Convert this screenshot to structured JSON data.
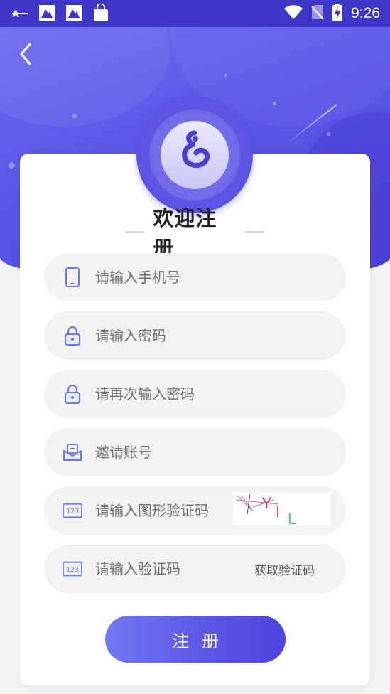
{
  "status_bar": {
    "time": "9:26"
  },
  "page": {
    "title": "欢迎注册"
  },
  "form": {
    "phone": {
      "placeholder": "请输入手机号"
    },
    "password": {
      "placeholder": "请输入密码"
    },
    "password_confirm": {
      "placeholder": "请再次输入密码"
    },
    "invite": {
      "placeholder": "邀请账号"
    },
    "image_captcha": {
      "placeholder": "请输入图形验证码",
      "captcha_text": "YIL"
    },
    "sms_code": {
      "placeholder": "请输入验证码",
      "action_label": "获取验证码"
    },
    "submit_label": "注册"
  },
  "colors": {
    "primary": "#5a55e4",
    "accent_light": "#6f78f2",
    "field_bg": "#f2f2f4",
    "icon": "#6b78ea"
  }
}
